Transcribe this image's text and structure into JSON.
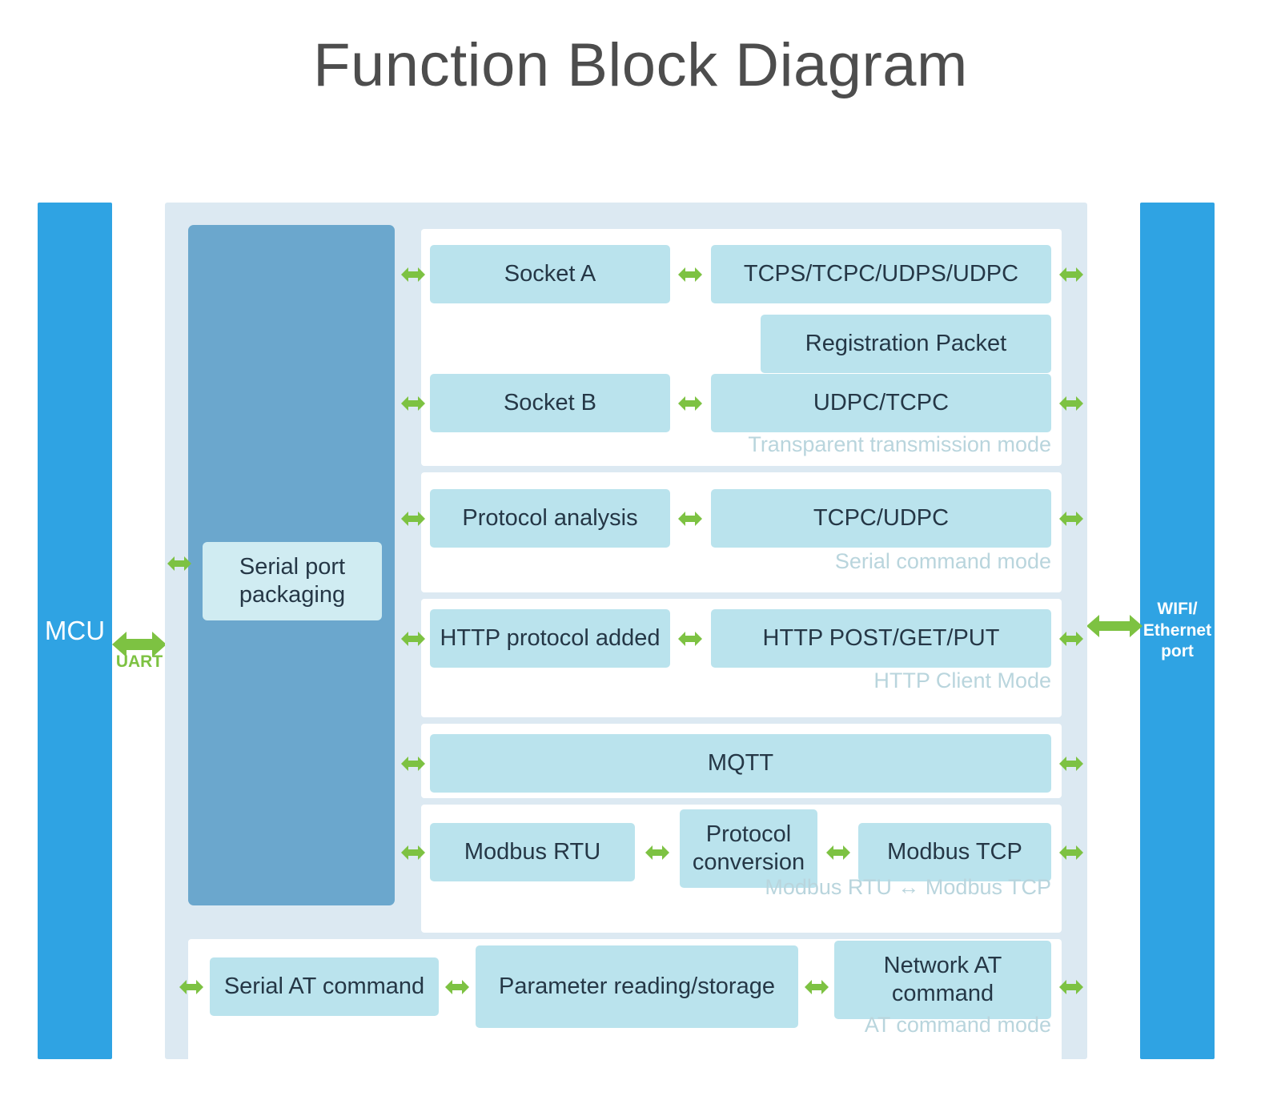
{
  "title": "Function Block Diagram",
  "colors": {
    "accent_blue": "#2fa3e3",
    "column_blue": "#6ba7cd",
    "block_blue": "#bae3ed",
    "container_bg": "#dce9f2",
    "panel_bg": "#ffffff",
    "arrow_green": "#7dc242",
    "text_dark": "#253746",
    "mode_label": "#b9d5dd",
    "title_gray": "#4d4d4d"
  },
  "endpoints": {
    "mcu": "MCU",
    "network_port": "WIFI/\nEthernet\nport",
    "uart_label": "UART"
  },
  "serial": {
    "packaging_label": "Serial port\npackaging"
  },
  "sections": [
    {
      "id": "transparent",
      "mode_label": "Transparent transmission mode",
      "blocks": [
        {
          "name": "socket-a",
          "label": "Socket A"
        },
        {
          "name": "socket-a-protocols",
          "label": "TCPS/TCPC/UDPS/UDPC"
        },
        {
          "name": "registration-packet",
          "label": "Registration Packet"
        },
        {
          "name": "socket-b",
          "label": "Socket B"
        },
        {
          "name": "socket-b-protocols",
          "label": "UDPC/TCPC"
        }
      ]
    },
    {
      "id": "serial-command",
      "mode_label": "Serial command mode",
      "blocks": [
        {
          "name": "protocol-analysis",
          "label": "Protocol analysis"
        },
        {
          "name": "tcpc-udpc",
          "label": "TCPC/UDPC"
        }
      ]
    },
    {
      "id": "http-client",
      "mode_label": "HTTP Client Mode",
      "blocks": [
        {
          "name": "http-protocol-added",
          "label": "HTTP protocol added"
        },
        {
          "name": "http-methods",
          "label": "HTTP POST/GET/PUT"
        }
      ]
    },
    {
      "id": "mqtt",
      "mode_label": "",
      "blocks": [
        {
          "name": "mqtt",
          "label": "MQTT"
        }
      ]
    },
    {
      "id": "modbus",
      "mode_label": "Modbus RTU ↔ Modbus TCP",
      "blocks": [
        {
          "name": "modbus-rtu",
          "label": "Modbus RTU"
        },
        {
          "name": "protocol-conversion",
          "label": "Protocol\nconversion"
        },
        {
          "name": "modbus-tcp",
          "label": "Modbus TCP"
        }
      ]
    },
    {
      "id": "at-command",
      "mode_label": "AT command mode",
      "blocks": [
        {
          "name": "serial-at-command",
          "label": "Serial AT command"
        },
        {
          "name": "parameter-storage",
          "label": "Parameter reading/storage"
        },
        {
          "name": "network-at-command",
          "label": "Network AT\ncommand"
        }
      ]
    }
  ]
}
